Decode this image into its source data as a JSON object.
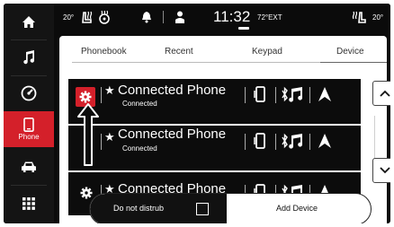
{
  "status": {
    "left_temp": "20°",
    "time": "11:32",
    "ext_temp": "72°EXT",
    "right_temp": "20°"
  },
  "sidebar": {
    "items": [
      {
        "icon": "home-icon",
        "label": ""
      },
      {
        "icon": "music-icon",
        "label": ""
      },
      {
        "icon": "gauge-icon",
        "label": ""
      },
      {
        "icon": "phone-icon",
        "label": "Phone",
        "active": true
      },
      {
        "icon": "car-icon",
        "label": ""
      },
      {
        "icon": "apps-grid-icon",
        "label": ""
      }
    ]
  },
  "tabs": [
    "Phonebook",
    "Recent",
    "Keypad",
    "Device"
  ],
  "devices": [
    {
      "name": "Connected Phone",
      "status": "Connected"
    },
    {
      "name": "Connected Phone",
      "status": "Connected"
    },
    {
      "name": "Connected Phone",
      "status": ""
    }
  ],
  "bottom": {
    "dnd_label": "Do not distrub",
    "add_device_label": "Add Device"
  },
  "colors": {
    "accent": "#d4202a",
    "background": "#0b0b0b",
    "panel": "#ffffff"
  }
}
